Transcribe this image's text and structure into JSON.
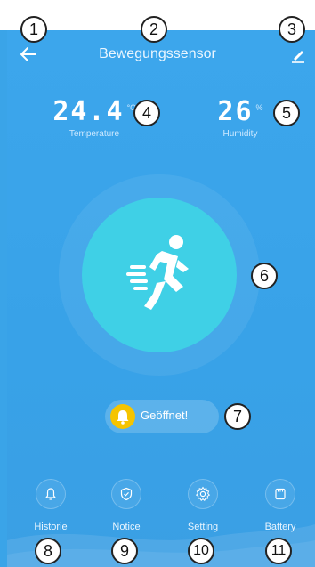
{
  "header": {
    "title": "Bewegungssensor"
  },
  "metrics": {
    "temperature": {
      "value": "24.4",
      "unit": "°C",
      "label": "Temperature"
    },
    "humidity": {
      "value": "26",
      "unit": "%",
      "label": "Humidity"
    }
  },
  "status": {
    "text": "Geöffnet!"
  },
  "nav": [
    {
      "label": "Historie",
      "icon": "bell-icon"
    },
    {
      "label": "Notice",
      "icon": "shield-icon"
    },
    {
      "label": "Setting",
      "icon": "gear-icon"
    },
    {
      "label": "Battery",
      "icon": "sd-card-icon"
    }
  ],
  "badges": [
    "1",
    "2",
    "3",
    "4",
    "5",
    "6",
    "7",
    "8",
    "9",
    "10",
    "11"
  ],
  "colors": {
    "background": "#3aa4e8",
    "circle": "#3fd0e6",
    "bell": "#f5c400"
  }
}
